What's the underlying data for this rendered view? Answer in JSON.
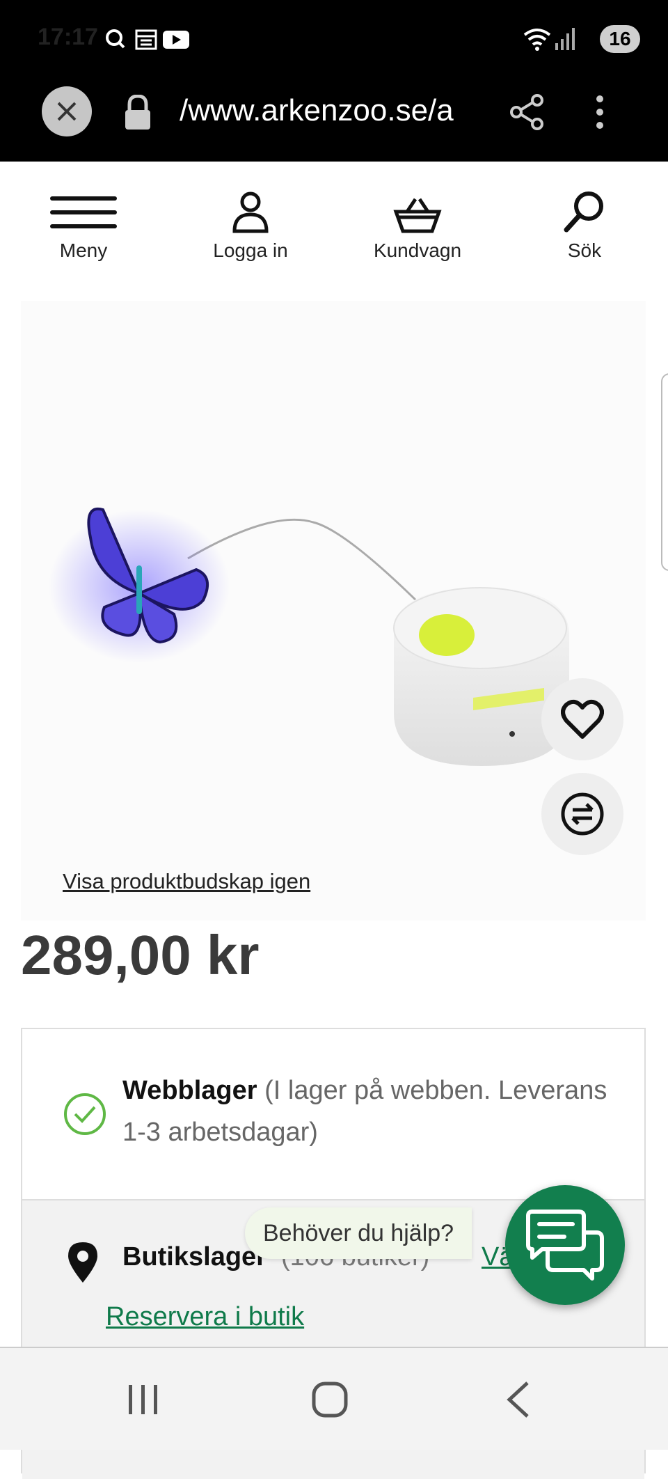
{
  "status_bar": {
    "time": "17:17",
    "battery": "16",
    "icons": [
      "search-icon",
      "news-icon",
      "youtube-icon",
      "wifi-icon",
      "signal-icon"
    ]
  },
  "browser": {
    "url": "/www.arkenzoo.se/a"
  },
  "site_nav": {
    "items": [
      {
        "label": "Meny",
        "icon": "hamburger-menu-icon"
      },
      {
        "label": "Logga in",
        "icon": "user-icon"
      },
      {
        "label": "Kundvagn",
        "icon": "basket-icon"
      },
      {
        "label": "Sök",
        "icon": "search-icon"
      }
    ]
  },
  "product": {
    "show_message_link": "Visa produktbudskap igen",
    "price": "289,00 kr"
  },
  "stock": {
    "web_label": "Webblager",
    "web_detail": "(I lager på webben. Leverans 1-3 arbetsdagar)",
    "store_label": "Butikslager",
    "store_count": "(106 butiker)",
    "store_link": "Vä",
    "reserve_link": "Reservera i butik"
  },
  "chat": {
    "prompt": "Behöver du hjälp?"
  },
  "colors": {
    "brand_green": "#127f4e",
    "check_green": "#5fb845",
    "link_green": "#0f7a4a"
  }
}
